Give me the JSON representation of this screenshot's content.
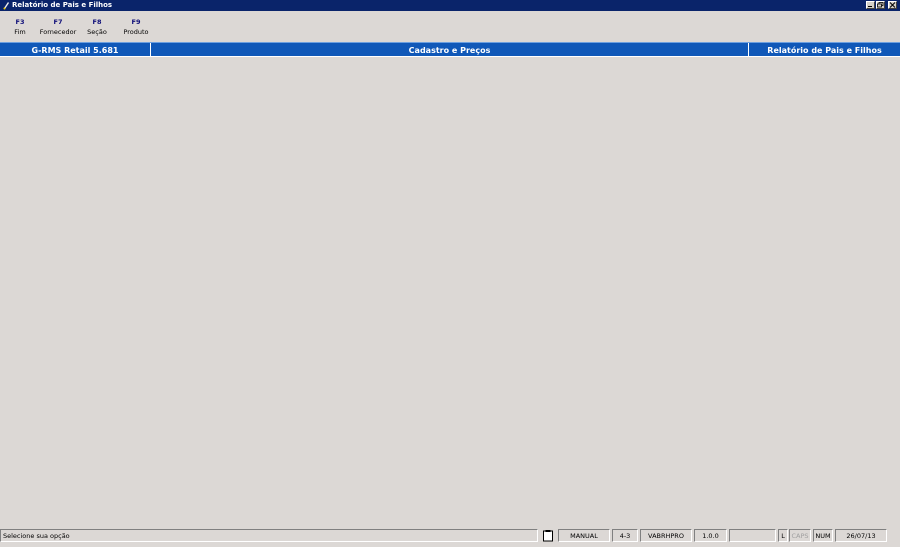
{
  "window": {
    "title": "Relatório de Pais e Filhos"
  },
  "toolbar": {
    "keys": [
      {
        "key": "F3",
        "label": "Fim"
      },
      {
        "key": "F7",
        "label": "Fornecedor"
      },
      {
        "key": "F8",
        "label": "Seção"
      },
      {
        "key": "F9",
        "label": "Produto"
      }
    ]
  },
  "header": {
    "product": "G-RMS Retail 5.681",
    "module": "Cadastro e Preços",
    "screen": "Relatório de Pais e Filhos"
  },
  "status": {
    "message": "Selecione sua opção",
    "mode": "MANUAL",
    "code": "4-3",
    "program": "VABRHPRO",
    "version": "1.0.0",
    "blank": "",
    "l": "L",
    "caps": "CAPS",
    "num": "NUM",
    "date": "26/07/13"
  },
  "colors": {
    "titlebar": "#0a246a",
    "header_bar": "#1058b8",
    "background": "#dcd8d5",
    "fkey": "#10107a"
  },
  "icons": {
    "app": "app-icon",
    "minimize": "minimize-icon",
    "maximize": "restore-icon",
    "close": "close-icon",
    "clipboard": "clipboard-icon"
  }
}
